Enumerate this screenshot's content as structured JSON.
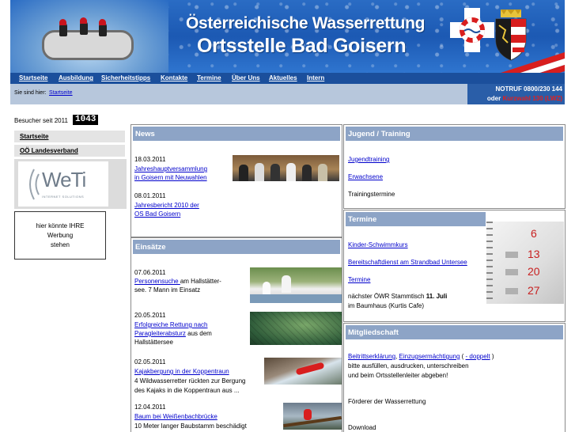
{
  "header": {
    "title_line1": "Österreichische Wasserrettung",
    "title_line2": "Ortsstelle Bad Goisern"
  },
  "nav": {
    "items": [
      "Startseite",
      "Ausbildung",
      "Sicherheitstipps",
      "Kontakte",
      "Termine",
      "Über Uns",
      "Aktuelles",
      "Intern"
    ]
  },
  "breadcrumb": {
    "label": "Sie sind hier:",
    "link": "Startseite"
  },
  "notruf": {
    "line1": "NOTRUF 0800/230 144",
    "line2_prefix": "oder ",
    "line2_highlight": "Kurzwahl 130 (LWZ)"
  },
  "sidebar": {
    "visitors_label": "Besucher seit 2011",
    "visitor_count": "1043",
    "links": [
      "Startseite",
      "OÖ Landesverband"
    ],
    "sponsor_logo": "WeTi",
    "sponsor_sub": "INTERNET SOLUTIONS",
    "ad_lines": [
      "hier könnte IHRE",
      "Werbung",
      "stehen"
    ]
  },
  "news": {
    "title": "News",
    "items": [
      {
        "date": "18.03.2011",
        "link_lines": [
          "Jahreshauptversammlung",
          "in Goisern  mit Neuwahlen"
        ]
      },
      {
        "date": " 08.01.2011",
        "link_lines": [
          "Jahresbericht 2010 der",
          "OS Bad Goisern"
        ]
      }
    ]
  },
  "einsaetze": {
    "title": "Einsätze",
    "items": [
      {
        "date": "07.06.2011",
        "link": "Personensuche ",
        "text_lines": [
          "am Hallstätter-",
          "see. 7 Mann im Einsatz"
        ]
      },
      {
        "date": "20.05.2011",
        "link_lines": [
          "Erfolgreiche Rettung nach",
          "Paragleiterabsturz"
        ],
        "text_lines": [
          " aus dem",
          "Hallstättersee"
        ]
      },
      {
        "date": "02.05.2011",
        "link": "Kajakbergung in der Koppentraun",
        "text_lines": [
          "4 Wildwasserretter rückten zur Bergung",
          "des Kajaks in die Koppentraun aus ..."
        ]
      },
      {
        "date": "12.04.2011",
        "link": "Baum bei Weißenbachbrücke",
        "text_lines": [
          "10 Meter langer Baubstamm beschädigt"
        ]
      }
    ]
  },
  "jugend": {
    "title": "Jugend / Training",
    "links": [
      "Jugendtraining",
      "Erwachsene"
    ],
    "text": "Trainingstermine"
  },
  "termine": {
    "title": "Termine",
    "links": [
      "Kinder-Schwimmkurs",
      "Bereitschaftdienst am Strandbad Untersee",
      "Termine"
    ],
    "event_prefix": "nächster ÖWR Stammtisch ",
    "event_bold": "11. Juli",
    "event_line2": "im Baumhaus (Kurtis Cafe)",
    "calendar_numbers": [
      "6",
      "13",
      "20",
      "27"
    ]
  },
  "mitglied": {
    "title": "Mitgliedschaft",
    "link1": "Beitrittserklärung",
    "sep": ", ",
    "link2": "Einzugsermächtigung",
    "paren_open": " ( ",
    "link3": "- doppelt",
    "paren_close": " )",
    "lines": [
      "bitte ausfüllen, ausdrucken, unterschreiben",
      "und beim Ortsstellenleiter abgeben!"
    ],
    "foerderer": "Förderer der Wasserrettung",
    "download": "Download"
  },
  "colors": {
    "nav_bg": "#1b4f9c",
    "panel_head": "#8da4c6",
    "crumb_bg": "#b7c7dc",
    "notruf_bg": "#2a5ea8",
    "link": "#0000cc",
    "alert": "#e02020"
  }
}
